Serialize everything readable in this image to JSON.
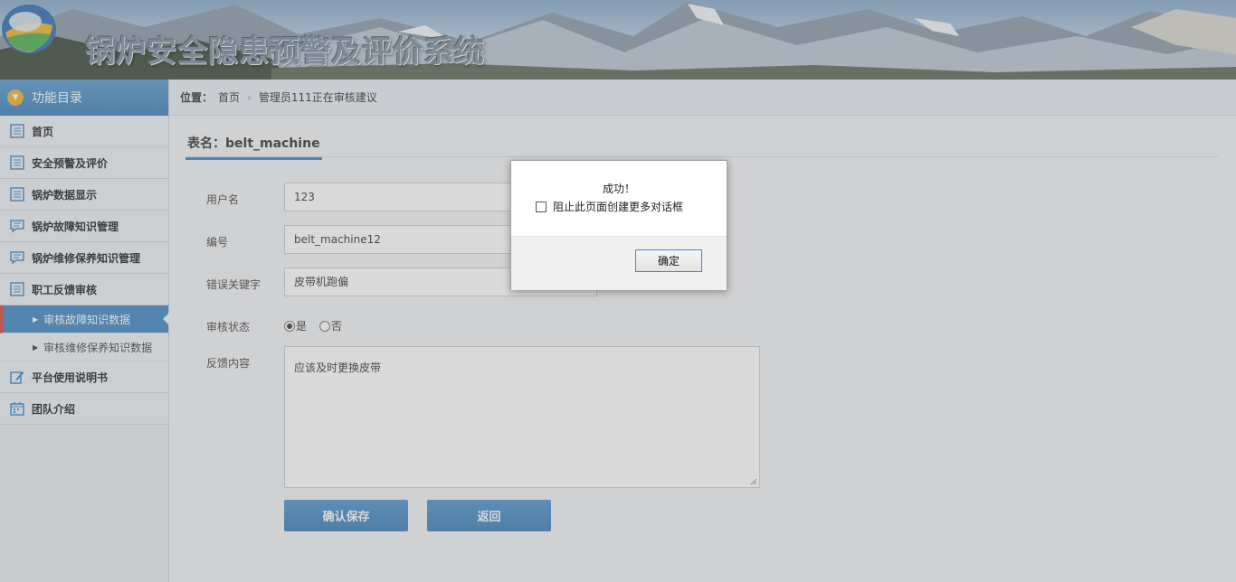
{
  "header": {
    "system_title": "锅炉安全隐患预警及评价系统"
  },
  "sidebar": {
    "heading": "功能目录",
    "items": [
      {
        "label": "首页",
        "icon": "list-icon"
      },
      {
        "label": "安全预警及评价",
        "icon": "list-icon"
      },
      {
        "label": "锅炉数据显示",
        "icon": "list-icon"
      },
      {
        "label": "锅炉故障知识管理",
        "icon": "chat-icon"
      },
      {
        "label": "锅炉维修保养知识管理",
        "icon": "chat-icon"
      },
      {
        "label": "职工反馈审核",
        "icon": "list-icon"
      },
      {
        "label": "平台使用说明书",
        "icon": "edit-icon"
      },
      {
        "label": "团队介绍",
        "icon": "calendar-icon"
      }
    ],
    "sub_items": [
      {
        "label": "审核故障知识数据",
        "active": true
      },
      {
        "label": "审核维修保养知识数据",
        "active": false
      }
    ]
  },
  "breadcrumb": {
    "label": "位置：",
    "home": "首页",
    "current": "管理员111正在审核建议"
  },
  "form": {
    "table_title": "表名：belt_machine",
    "username_label": "用户名",
    "username_value": "123",
    "code_label": "编号",
    "code_value": "belt_machine12",
    "keyword_label": "错误关键字",
    "keyword_value": "皮带机跑偏",
    "status_label": "审核状态",
    "status_yes": "是",
    "status_no": "否",
    "status_selected": "是",
    "feedback_label": "反馈内容",
    "feedback_value": "应该及时更换皮带",
    "save_button": "确认保存",
    "back_button": "返回"
  },
  "dialog": {
    "message": "成功！",
    "checkbox_label": "阻止此页面创建更多对话框",
    "ok_button": "确定"
  },
  "colors": {
    "accent": "#3f87c3",
    "active_marker": "#d9443f",
    "menu_icon": "#f0b32f"
  }
}
